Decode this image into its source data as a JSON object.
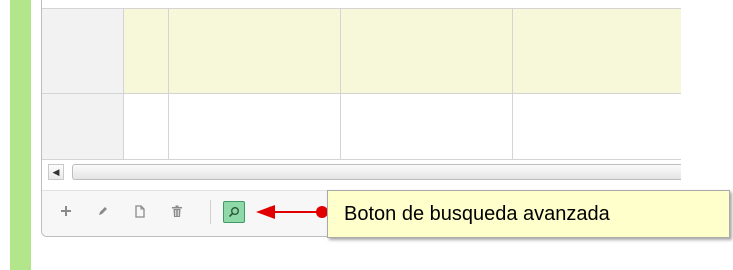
{
  "colors": {
    "accent_bar": "#b3e58b",
    "highlight_row": "#f7f7d9",
    "rownum_column": "#f2f2f2",
    "search_button": "#8fd8a8",
    "arrow": "#e00000",
    "tooltip_bg": "#ffffcc"
  },
  "toolbar": {
    "buttons": [
      {
        "icon": "plus-icon",
        "glyph": "+"
      },
      {
        "icon": "pencil-icon"
      },
      {
        "icon": "document-icon"
      },
      {
        "icon": "trash-icon"
      },
      {
        "icon": "search-icon",
        "active": true
      },
      {
        "icon": "refresh-icon"
      }
    ]
  },
  "scrollbar": {
    "left_arrow": "◀"
  },
  "callout": {
    "text": "Boton de busqueda avanzada"
  }
}
